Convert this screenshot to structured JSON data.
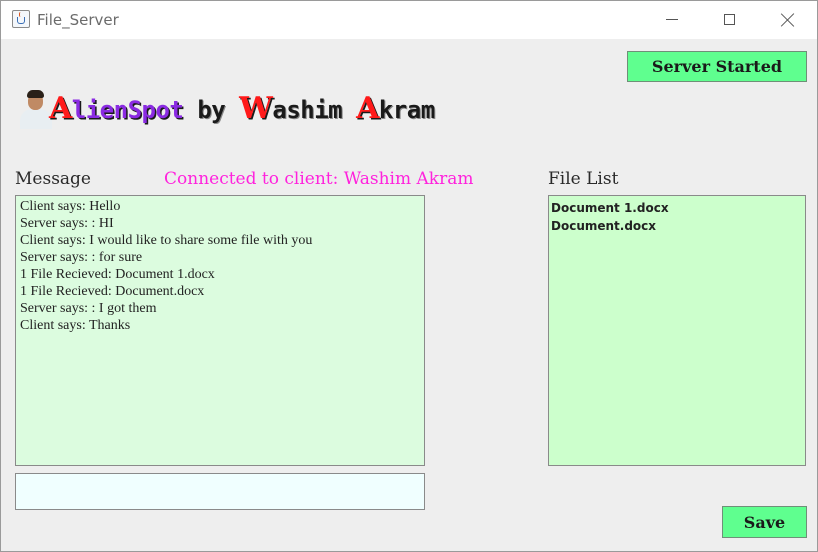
{
  "window": {
    "title": "File_Server",
    "icon": "java-cup-icon",
    "controls": [
      "minimize-icon",
      "maximize-icon",
      "close-icon"
    ]
  },
  "header": {
    "server_button_label": "Server Started",
    "logo": {
      "parts": [
        {
          "text": "A",
          "style": "cap"
        },
        {
          "text": "lienSpot",
          "style": "purple"
        },
        {
          "text": " by ",
          "style": "dark"
        },
        {
          "text": "W",
          "style": "cap"
        },
        {
          "text": "ashim ",
          "style": "dark"
        },
        {
          "text": "A",
          "style": "cap"
        },
        {
          "text": "kram",
          "style": "dark"
        }
      ]
    }
  },
  "message_panel": {
    "label": "Message",
    "connection_status": "Connected to client: Washim Akram",
    "lines": [
      "Client says: Hello",
      "Server says: : HI",
      "Client says: I would like to share some file with you",
      "Server says: : for sure",
      "1 File Recieved: Document 1.docx",
      "1 File Recieved: Document.docx",
      "Server says: : I got them",
      "Client says: Thanks"
    ],
    "input_value": ""
  },
  "file_panel": {
    "label": "File List",
    "files": [
      "Document 1.docx",
      "Document.docx"
    ]
  },
  "footer": {
    "save_label": "Save"
  },
  "colors": {
    "button_green": "#5fff8f",
    "message_bg": "#dcfcdf",
    "file_list_bg": "#ccffcc",
    "input_bg": "#f0ffff",
    "status_magenta": "#ff22dd",
    "logo_red": "#ff1a1a",
    "logo_purple": "#8a2be2"
  }
}
